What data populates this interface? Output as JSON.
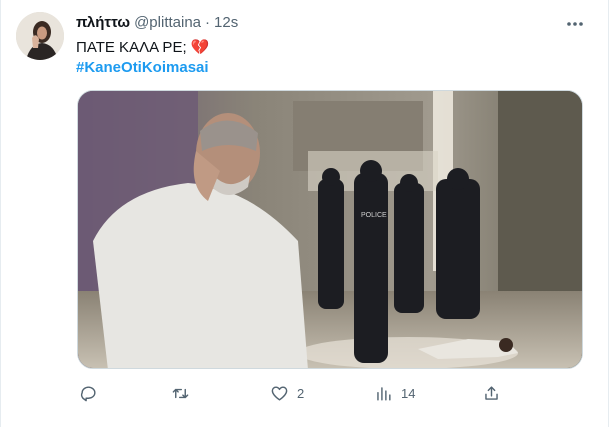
{
  "tweet": {
    "author": {
      "display_name": "πλήττω",
      "handle": "@plittaina",
      "separator": "·",
      "time": "12s"
    },
    "text": "ΠΑΤΕ ΚΑΛΑ ΡΕ; 💔",
    "hashtag": "#KaneOtiKoimasai",
    "media": {
      "police_vest_text": "POLICE"
    },
    "actions": {
      "reply_count": "",
      "retweet_count": "",
      "like_count": "2",
      "views_count": "14"
    },
    "icons": {
      "more": "more-horizontal-icon",
      "reply": "reply-icon",
      "retweet": "retweet-icon",
      "like": "heart-icon",
      "views": "views-icon",
      "share": "share-icon"
    },
    "colors": {
      "hashtag": "#1d9bf0",
      "secondary_text": "#536471",
      "primary_text": "#0f1419"
    }
  }
}
